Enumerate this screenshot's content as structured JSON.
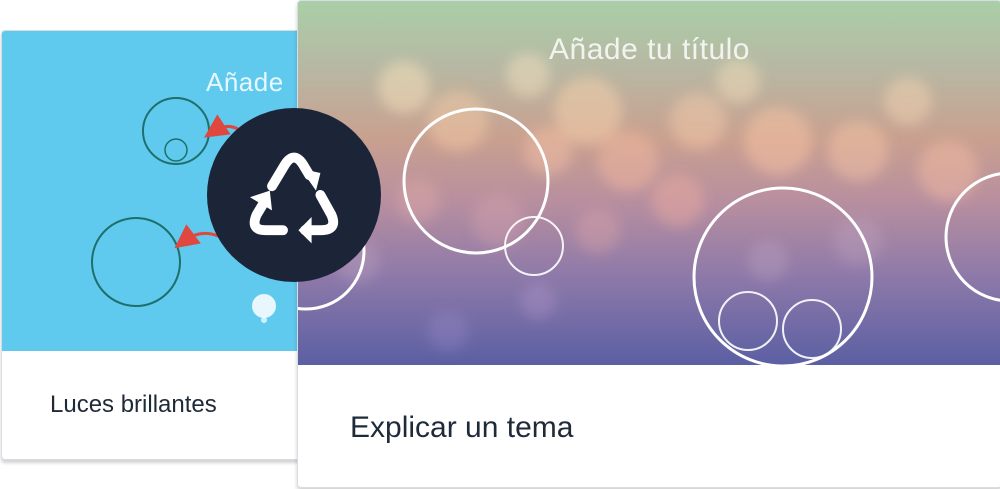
{
  "back_card": {
    "thumbnail_title": "Añade",
    "label": "Luces brillantes",
    "thumbnail_color": "#5fc9ee"
  },
  "front_card": {
    "thumbnail_title": "Añade tu título",
    "label": "Explicar un tema"
  },
  "swap_button": {
    "icon": "recycle-icon",
    "color": "#1b2537"
  },
  "colors": {
    "text": "#1f2a38",
    "card_border": "#d8dde3"
  }
}
